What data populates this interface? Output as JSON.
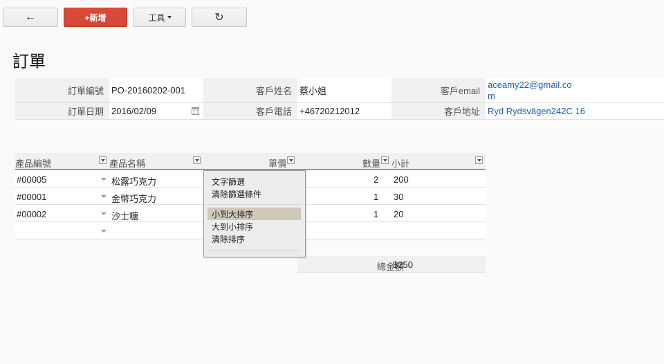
{
  "toolbar": {
    "back_label": "←",
    "new_label": "+新增",
    "tools_label": "工具",
    "refresh_label": "↻"
  },
  "page_title": "訂單",
  "form": {
    "order_no_label": "訂單編號",
    "order_no": "PO-20160202-001",
    "customer_name_label": "客戶姓名",
    "customer_name": "蔡小姐",
    "email_label": "客戶email",
    "email_line1": "aceamy22@gmail.co",
    "email_line2": "m",
    "order_date_label": "訂單日期",
    "order_date": "2016/02/09",
    "phone_label": "客戶電話",
    "phone": "+46720212012",
    "address_label": "客戶地址",
    "address": "Ryd Rydsvägen242C 16"
  },
  "grid": {
    "columns": [
      "產品編號",
      "產品名稱",
      "單價",
      "數量",
      "小計"
    ],
    "rows": [
      {
        "id": "#00005",
        "name": "松露巧克力",
        "price": "",
        "qty": "2",
        "subtotal": "200"
      },
      {
        "id": "#00001",
        "name": "金幣巧克力",
        "price": "",
        "qty": "1",
        "subtotal": "30"
      },
      {
        "id": "#00002",
        "name": "沙士糖",
        "price": "",
        "qty": "1",
        "subtotal": "20"
      }
    ],
    "total_label": "總金額",
    "total_value": "$250"
  },
  "menu": {
    "items": [
      "文字篩選",
      "清除篩選條件",
      "小到大排序",
      "大到小排序",
      "清除排序"
    ],
    "active_index": 2
  },
  "colors": {
    "accent": "#dd4b39",
    "link": "#1a5fb4",
    "menu_highlight": "#cfcab8"
  }
}
